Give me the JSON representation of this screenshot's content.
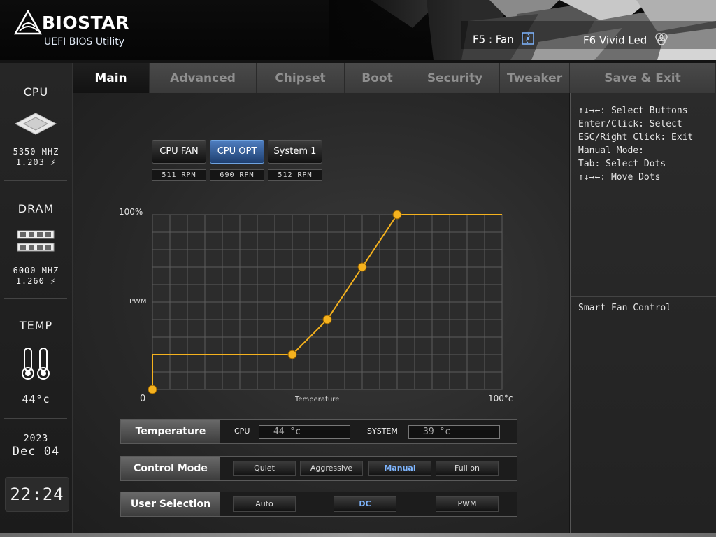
{
  "header": {
    "brand": "BIOSTAR",
    "subtitle": "UEFI BIOS Utility",
    "hotkey_fan": "F5 : Fan",
    "hotkey_led": "F6  Vivid Led"
  },
  "sidebar": {
    "cpu": {
      "title": "CPU",
      "freq": "5350 MHZ",
      "volt": "1.203 ⚡"
    },
    "dram": {
      "title": "DRAM",
      "freq": "6000 MHZ",
      "volt": "1.260 ⚡"
    },
    "temp": {
      "title": "TEMP",
      "value": "44°c"
    },
    "date": {
      "year": "2023",
      "day": "Dec 04"
    },
    "clock": "22:24"
  },
  "tabs": [
    {
      "label": "Main",
      "active": true
    },
    {
      "label": "Advanced"
    },
    {
      "label": "Chipset"
    },
    {
      "label": "Boot"
    },
    {
      "label": "Security"
    },
    {
      "label": "Tweaker"
    },
    {
      "label": "Save & Exit"
    }
  ],
  "fans": [
    {
      "label": "CPU FAN",
      "rpm": "511 RPM"
    },
    {
      "label": "CPU OPT",
      "rpm": "690 RPM",
      "active": true
    },
    {
      "label": "System 1",
      "rpm": "512 RPM"
    }
  ],
  "chart_data": {
    "type": "line",
    "x": [
      0,
      40,
      50,
      60,
      70,
      100
    ],
    "y": [
      0,
      20,
      40,
      70,
      100,
      100
    ],
    "start_y": 20,
    "xlabel": "Temperature",
    "ylabel": "PWM",
    "xlim": [
      0,
      100
    ],
    "ylim": [
      0,
      100
    ],
    "x_tick_labels": [
      "0",
      "100°c"
    ],
    "y_tick_labels": [
      "100%"
    ],
    "grid": true,
    "line_color": "#f5b21e"
  },
  "temperature_row": {
    "label": "Temperature",
    "cpu_label": "CPU",
    "cpu_value": "44 °c",
    "system_label": "SYSTEM",
    "system_value": "39 °c"
  },
  "control_mode": {
    "label": "Control Mode",
    "options": [
      "Quiet",
      "Aggressive",
      "Manual",
      "Full on"
    ],
    "selected": "Manual"
  },
  "user_selection": {
    "label": "User Selection",
    "options": [
      "Auto",
      "DC",
      "PWM"
    ],
    "selected": "DC"
  },
  "help": {
    "lines": "↑↓→←: Select Buttons\nEnter/Click: Select\nESC/Right Click: Exit\nManual Mode:\nTab: Select Dots\n↑↓→←: Move Dots",
    "description": "Smart Fan Control"
  },
  "colors": {
    "accent": "#f5b21e",
    "active_tab": "#121212",
    "selected": "#7fb6ff"
  }
}
